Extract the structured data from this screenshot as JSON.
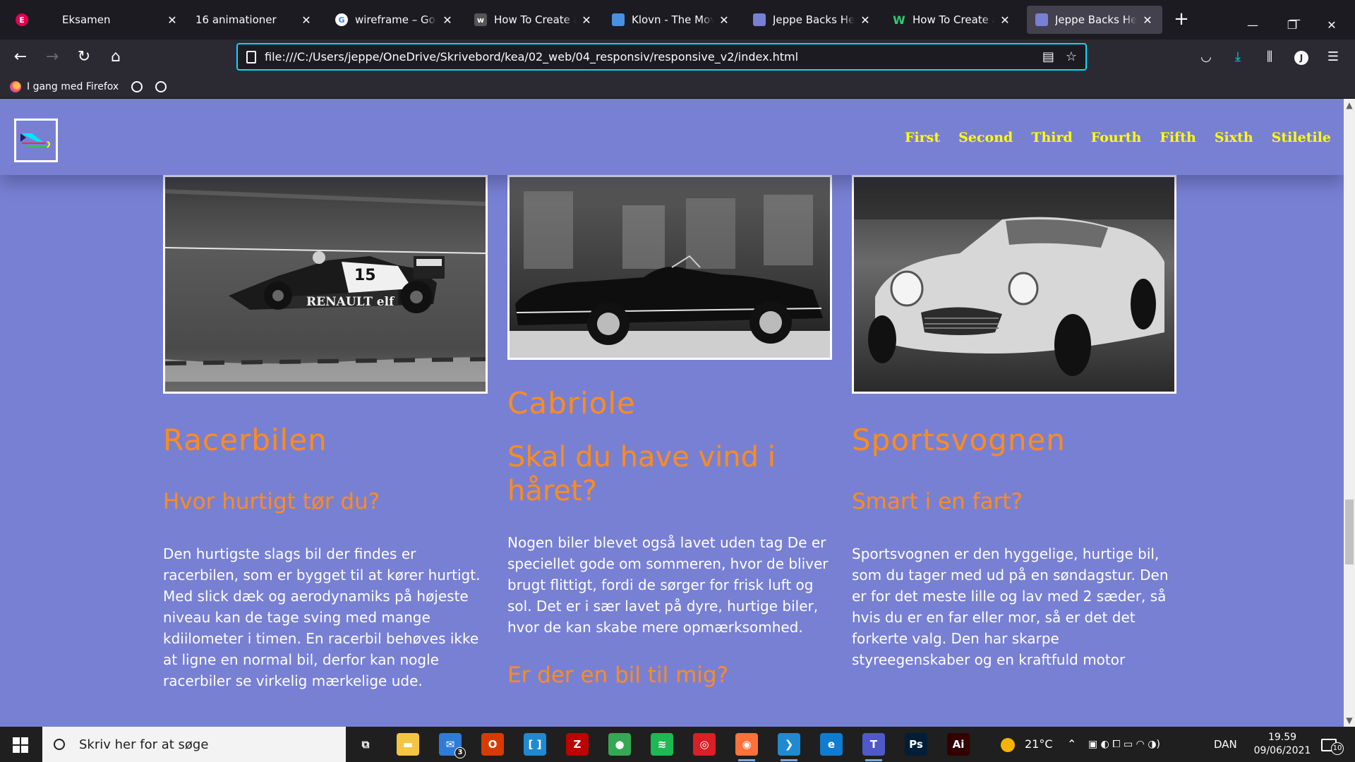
{
  "browser": {
    "tabs": [
      {
        "title": "Eksamen",
        "icon": "elementor-icon",
        "color": "#e2004f"
      },
      {
        "title": "16 animationer",
        "icon": "blank-page-icon",
        "color": "#1c1b22"
      },
      {
        "title": "wireframe – Google",
        "icon": "google-icon",
        "color": "#ffffff"
      },
      {
        "title": "How To Create a G",
        "icon": "w3schools-icon",
        "color": "#555555"
      },
      {
        "title": "Klovn - The Movie",
        "icon": "site-icon",
        "color": "#4a90e2"
      },
      {
        "title": "Jeppe Backs Henrik",
        "icon": "site-icon",
        "color": "#7880d4"
      },
      {
        "title": "How To Create a M",
        "icon": "webflow-icon",
        "color": "#1c1b22"
      },
      {
        "title": "Jeppe Backs Henrik",
        "icon": "site-icon",
        "color": "#7880d4",
        "active": true
      }
    ],
    "url": "file:///C:/Users/jeppe/OneDrive/Skrivebord/kea/02_web/04_responsiv/responsive_v2/index.html",
    "bookmarks": {
      "item": "I gang med Firefox"
    },
    "profile_initial": "J"
  },
  "site": {
    "nav": [
      "First",
      "Second",
      "Third",
      "Fourth",
      "Fifth",
      "Sixth",
      "Stiletile"
    ],
    "cards": [
      {
        "title": "Racerbilen",
        "subtitle": "Hvor hurtigt tør du?",
        "text": "Den hurtigste slags bil der findes er racerbilen, som er bygget til at kører hurtigt. Med slick dæk og aerodynamiks på højeste niveau kan de tage sving med mange kdiilometer i timen. En racerbil behøves ikke at ligne en normal bil, derfor kan nogle racerbiler se virkelig mærkelige ude.",
        "car_number": "15",
        "sponsor": "RENAULT elf"
      },
      {
        "title": "Cabriole",
        "subtitle": "Skal du have vind i håret?",
        "text": "Nogen biler blevet også lavet uden tag De er speciellet gode om sommeren, hvor de bliver brugt flittigt, fordi de sørger for frisk luft og sol. Det er i sær lavet på dyre, hurtige biler, hvor de kan skabe mere opmærksomhed.",
        "subtitle2": "Er der en bil til mig?"
      },
      {
        "title": "Sportsvognen",
        "subtitle": "Smart i en fart?",
        "text": "Sportsvognen er den hyggelige, hurtige bil, som du tager med ud på en søndagstur. Den er for det meste lille og lav med 2 sæder, så hvis du er en far eller mor, så er det det forkerte valg. Den har skarpe styreegenskaber og en kraftfuld motor"
      }
    ],
    "colors": {
      "background": "#7880d4",
      "heading": "#ff8c1a",
      "nav": "#ffff00"
    }
  },
  "taskbar": {
    "search_placeholder": "Skriv her for at søge",
    "apps": [
      {
        "name": "task-view-icon",
        "label": "⧉",
        "color": "#1f1f1f"
      },
      {
        "name": "file-explorer-icon",
        "label": "▬",
        "color": "#f4c542"
      },
      {
        "name": "mail-icon",
        "label": "✉",
        "color": "#2f7bd8",
        "badge": "3"
      },
      {
        "name": "office-icon",
        "label": "O",
        "color": "#d83b01"
      },
      {
        "name": "brackets-icon",
        "label": "[ ]",
        "color": "#1f8ad2"
      },
      {
        "name": "filezilla-icon",
        "label": "Z",
        "color": "#bf0000"
      },
      {
        "name": "chrome-icon",
        "label": "●",
        "color": "#34a853"
      },
      {
        "name": "spotify-icon",
        "label": "≋",
        "color": "#1db954"
      },
      {
        "name": "creative-cloud-icon",
        "label": "◎",
        "color": "#da1f26"
      },
      {
        "name": "firefox-icon",
        "label": "◉",
        "color": "#ff7139"
      },
      {
        "name": "vscode-icon",
        "label": "❯",
        "color": "#1f8ad2"
      },
      {
        "name": "edge-icon",
        "label": "e",
        "color": "#0f7ccf"
      },
      {
        "name": "teams-icon",
        "label": "T",
        "color": "#5059c9"
      },
      {
        "name": "photoshop-icon",
        "label": "Ps",
        "color": "#001e36"
      },
      {
        "name": "illustrator-icon",
        "label": "Ai",
        "color": "#330000"
      }
    ],
    "temperature": "21°C",
    "language": "DAN",
    "time": "19.59",
    "date": "09/06/2021",
    "notifications": "10"
  }
}
